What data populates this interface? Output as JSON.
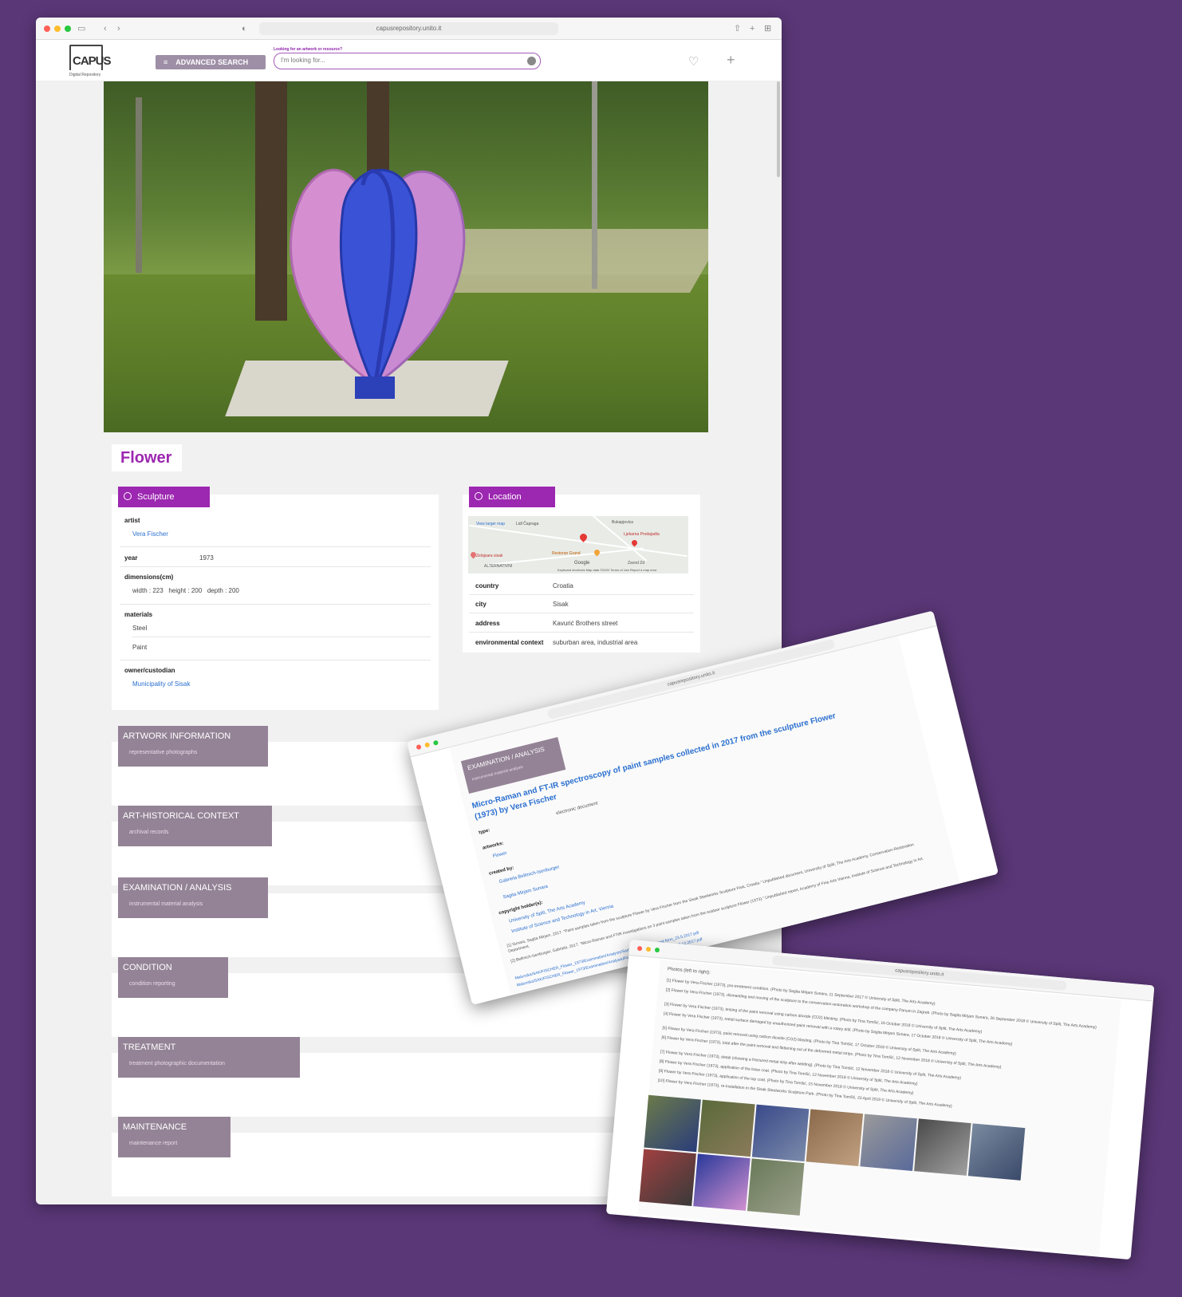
{
  "browser": {
    "url": "capusrepository.unito.it"
  },
  "header": {
    "logo_text": "CAPUS",
    "logo_sub": "Digital Repository",
    "advanced_search": "ADVANCED SEARCH",
    "search_hint": "Looking for an artwork or resource?",
    "search_placeholder": "I'm looking for..."
  },
  "artwork": {
    "title": "Flower",
    "type": "Sculpture",
    "artist_label": "artist",
    "artist": "Vera Fischer",
    "year_label": "year",
    "year": "1973",
    "dimensions_label": "dimensions(cm)",
    "dimensions": "width : 223   height : 200   depth : 200",
    "materials_label": "materials",
    "materials": [
      "Steel",
      "Paint"
    ],
    "owner_label": "owner/custodian",
    "owner": "Municipality of Sisak"
  },
  "location": {
    "tag": "Location",
    "map_labels": {
      "view_larger": "View larger map",
      "place1": "Lidl Čapraga",
      "place2": "Bukapjevica",
      "place3": "Restoran Grand",
      "place4": "Ljekarna Prodajadta",
      "place5": "Zelajsara sisak",
      "place6": "ALTERNATIVNI",
      "google": "Google",
      "place7": "Zavod Zd",
      "footer": "Keyboard shortcuts   Map data ©2022   Terms of Use   Report a map error"
    },
    "rows": [
      {
        "label": "country",
        "value": "Croatia"
      },
      {
        "label": "city",
        "value": "Sisak"
      },
      {
        "label": "address",
        "value": "Kavurić Brothers street"
      },
      {
        "label": "environmental context",
        "value": "suburban area, industrial area"
      }
    ]
  },
  "sections": [
    {
      "title": "ARTWORK INFORMATION",
      "sub": "representative photographs"
    },
    {
      "title": "ART-HISTORICAL CONTEXT",
      "sub": "archival records"
    },
    {
      "title": "EXAMINATION / ANALYSIS",
      "sub": "instrumental material analysis"
    },
    {
      "title": "CONDITION",
      "sub": "condition reporting"
    },
    {
      "title": "TREATMENT",
      "sub": "treatment photographic documentation"
    },
    {
      "title": "MAINTENANCE",
      "sub": "maintenance report"
    }
  ],
  "overlay1": {
    "url": "capusrepository.unito.it",
    "tag_title": "EXAMINATION / ANALYSIS",
    "tag_sub": "instrumental material analysis",
    "doc_title": "Micro-Raman and FT-IR spectroscopy of paint samples collected in 2017 from the sculpture Flower (1973) by Vera Fischer",
    "type_label": "type:",
    "type_value": "electronic document",
    "artworks_label": "artworks:",
    "artworks_value": "Flower",
    "created_label": "created by:",
    "created": [
      "Gabriela Bellmich-Isenburger",
      "Sagita Mirjam Sunara"
    ],
    "copyright_label": "copyright holder(s):",
    "copyright": [
      "University of Split, The Arts Academy",
      "Institute of Science and Technology in Art, Vienna"
    ],
    "ref1": "[1] Sunara, Sagita Mirjam. 2017. \"Paint samples taken from the sculpture Flower by Vera Fischer from the Sisak Steelworks Sculpture Park, Croatia.\" Unpublished document, University of Split, The Arts Academy, Conservation-Restoration Department.",
    "ref2": "[2] Bellmich-Isenburger, Gabriela. 2017. \"Micro-Raman and FTIR investigations on 3 paint samples taken from the outdoor sculpture Flower (1973).\" Unpublished report, Academy of Fine Arts Vienna, Institute of Science and Technology in Art.",
    "link1": "Malunska/SAK/FISCHER_Flower_1973/Examination/Analysis/Sample analysis request form_23.5.2017.pdf",
    "link2": "Malunska/SAK/FISCHER_Flower_1973/Examination/Analysis/Paint samples analysis report_18.12.2017.pdf"
  },
  "overlay2": {
    "url": "capusrepository.unito.it",
    "heading": "Photos (left to right):",
    "captions": [
      "[1] Flower by Vera Fischer (1973), pre-treatment condition. (Photo by Sagita Mirjam Sunara, 11 September 2017 © University of Split, The Arts Academy)",
      "[2] Flower by Vera Fischer (1973), dismantling and moving of the sculpture to the conservation-restoration workshop of the company Panum in Zagreb. (Photo by Sagita Mirjam Sunara, 26 September 2018 © University of Split, The Arts Academy)",
      "[3] Flower by Vera Fischer (1973), testing of the paint removal using carbon dioxide (CO2) blasting. (Photo by Tina Tomšić, 16 October 2018 © University of Split, The Arts Academy)",
      "[4] Flower by Vera Fischer (1973), metal surface damaged by unauthorized paint removal with a rotary drill. (Photo by Sagita Mirjam Sunara, 17 October 2018 © University of Split, The Arts Academy)",
      "[5] Flower by Vera Fischer (1973), paint removal using carbon dioxide (CO2) blasting. (Photo by Tina Tomšić, 17 October 2018 © University of Split, The Arts Academy)",
      "[6] Flower by Vera Fischer (1973), total after the paint removal and flattening out of the deformed metal strips. (Photo by Tina Tomšić, 12 November 2018 © University of Split, The Arts Academy)",
      "[7] Flower by Vera Fischer (1973), detail (showing a fractured metal strip after welding). (Photo by Tina Tomšić, 12 November 2018 © University of Split, The Arts Academy)",
      "[8] Flower by Vera Fischer (1973), application of the base coat. (Photo by Tina Tomšić, 12 November 2018 © University of Split, The Arts Academy)",
      "[9] Flower by Vera Fischer (1973), application of the top coat. (Photo by Tina Tomšić, 15 November 2018 © University of Split, The Arts Academy)",
      "[10] Flower by Vera Fischer (1973), re-installation in the Sisak Steelworks Sculpture Park. (Photo by Tina Tomšić, 23 April 2019 © University of Split, The Arts Academy)"
    ]
  },
  "colors": {
    "accent": "#9c27b0",
    "section_tag": "#948396",
    "background": "#5a3777",
    "link": "#2a6fcf"
  }
}
